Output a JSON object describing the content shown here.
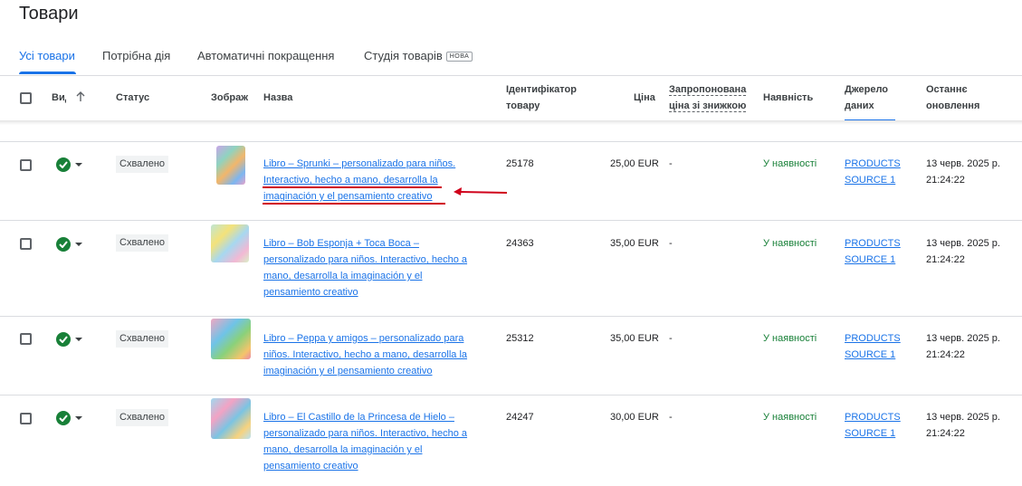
{
  "page": {
    "title": "Товари"
  },
  "tabs": [
    {
      "label": "Усі товари",
      "active": true
    },
    {
      "label": "Потрібна дія"
    },
    {
      "label": "Автоматичні покращення"
    },
    {
      "label": "Студія товарів",
      "badge": "НОВА"
    }
  ],
  "table": {
    "headers": {
      "visibility": "Вид",
      "status": "Статус",
      "image": "Зображ",
      "name": "Назва",
      "id": [
        "Ідентифікатор",
        "товару"
      ],
      "price": "Ціна",
      "sale_price": [
        "Запропонована",
        "ціна зі знижкою"
      ],
      "availability": "Наявність",
      "source": [
        "Джерело",
        "даних"
      ],
      "updated": [
        "Останнє",
        "оновлення"
      ]
    },
    "rows": [
      {
        "status": "Схвалено",
        "title_lines": [
          "Libro – Sprunki – personalizado para niños.",
          "Interactivo, hecho a mano, desarrolla la",
          "imaginación y el pensamiento creativo"
        ],
        "id": "25178",
        "price": "25,00 EUR",
        "sale_price": "-",
        "availability": "У наявності",
        "source": [
          "PRODUCTS",
          "SOURCE 1"
        ],
        "updated": [
          "13 черв. 2025 р.",
          "21:24:22"
        ]
      },
      {
        "status": "Схвалено",
        "title_lines": [
          "Libro – Bob Esponja + Toca Boca –",
          "personalizado para niños. Interactivo, hecho a",
          "mano, desarrolla la imaginación y el",
          "pensamiento creativo"
        ],
        "id": "24363",
        "price": "35,00 EUR",
        "sale_price": "-",
        "availability": "У наявності",
        "source": [
          "PRODUCTS",
          "SOURCE 1"
        ],
        "updated": [
          "13 черв. 2025 р.",
          "21:24:22"
        ]
      },
      {
        "status": "Схвалено",
        "title_lines": [
          "Libro – Peppa y amigos – personalizado para",
          "niños. Interactivo, hecho a mano, desarrolla la",
          "imaginación y el pensamiento creativo"
        ],
        "id": "25312",
        "price": "35,00 EUR",
        "sale_price": "-",
        "availability": "У наявності",
        "source": [
          "PRODUCTS",
          "SOURCE 1"
        ],
        "updated": [
          "13 черв. 2025 р.",
          "21:24:22"
        ]
      },
      {
        "status": "Схвалено",
        "title_lines": [
          "Libro – El Castillo de la Princesa de Hielo –",
          "personalizado para niños. Interactivo, hecho a",
          "mano, desarrolla la imaginación y el",
          "pensamiento creativo"
        ],
        "id": "24247",
        "price": "30,00 EUR",
        "sale_price": "-",
        "availability": "У наявності",
        "source": [
          "PRODUCTS",
          "SOURCE 1"
        ],
        "updated": [
          "13 черв. 2025 р.",
          "21:24:22"
        ]
      }
    ]
  },
  "colors": {
    "accent": "#1a73e8",
    "approved": "#188038",
    "annotation": "#d0021b"
  },
  "icons": {
    "status": "check-circle-icon",
    "sort": "arrow-up-icon",
    "menu": "caret-down-icon"
  }
}
